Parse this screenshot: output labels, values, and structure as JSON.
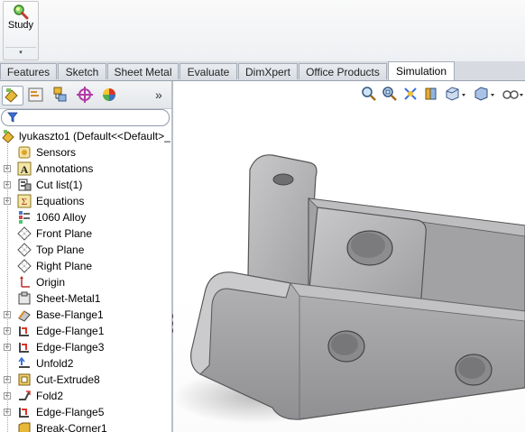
{
  "ribbon": {
    "study_label": "Study",
    "dropdown_glyph": "▾"
  },
  "tabs": [
    {
      "label": "Features"
    },
    {
      "label": "Sketch"
    },
    {
      "label": "Sheet Metal"
    },
    {
      "label": "Evaluate"
    },
    {
      "label": "DimXpert"
    },
    {
      "label": "Office Products"
    },
    {
      "label": "Simulation",
      "active": true
    }
  ],
  "feature_manager": {
    "toolbar_icons": [
      "feature-tree-icon",
      "property-manager-icon",
      "configuration-manager-icon",
      "dimxpert-manager-icon",
      "display-manager-icon"
    ],
    "more_glyph": "»",
    "filter_icon": "funnel-icon",
    "root": {
      "label": "lyukaszto1  (Default<<Default>_",
      "icon": "part-icon"
    },
    "items": [
      {
        "label": "Sensors",
        "icon": "sensor-icon",
        "expandable": false
      },
      {
        "label": "Annotations",
        "icon": "annotation-icon",
        "expandable": true
      },
      {
        "label": "Cut list(1)",
        "icon": "cut-list-icon",
        "expandable": true
      },
      {
        "label": "Equations",
        "icon": "equations-icon",
        "expandable": true
      },
      {
        "label": "1060 Alloy",
        "icon": "material-icon",
        "expandable": false
      },
      {
        "label": "Front Plane",
        "icon": "plane-icon",
        "expandable": false
      },
      {
        "label": "Top Plane",
        "icon": "plane-icon",
        "expandable": false
      },
      {
        "label": "Right Plane",
        "icon": "plane-icon",
        "expandable": false
      },
      {
        "label": "Origin",
        "icon": "origin-icon",
        "expandable": false
      },
      {
        "label": "Sheet-Metal1",
        "icon": "sheet-metal-icon",
        "expandable": false
      },
      {
        "label": "Base-Flange1",
        "icon": "base-flange-icon",
        "expandable": true
      },
      {
        "label": "Edge-Flange1",
        "icon": "edge-flange-icon",
        "expandable": true
      },
      {
        "label": "Edge-Flange3",
        "icon": "edge-flange-icon",
        "expandable": true
      },
      {
        "label": "Unfold2",
        "icon": "unfold-icon",
        "expandable": false
      },
      {
        "label": "Cut-Extrude8",
        "icon": "cut-extrude-icon",
        "expandable": true
      },
      {
        "label": "Fold2",
        "icon": "fold-icon",
        "expandable": true
      },
      {
        "label": "Edge-Flange5",
        "icon": "edge-flange-icon",
        "expandable": true
      },
      {
        "label": "Break-Corner1",
        "icon": "break-corner-icon",
        "expandable": false
      }
    ]
  },
  "view_toolbar": {
    "icons": [
      "zoom-to-fit-icon",
      "zoom-to-area-icon",
      "previous-view-icon",
      "section-view-icon",
      "view-orientation-icon",
      "display-style-icon",
      "hide-show-items-icon"
    ]
  },
  "colors": {
    "part_fill": "#a9a9ab",
    "part_dark": "#8a8a8d",
    "part_light": "#cfcfd1",
    "tab_active": "#ffffff"
  }
}
